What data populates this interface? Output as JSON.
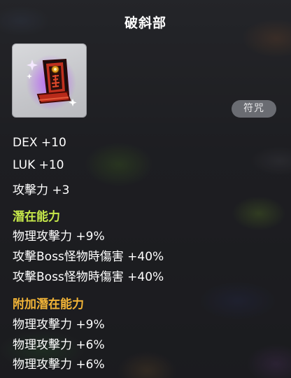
{
  "item": {
    "name": "破斜部",
    "category": "符咒",
    "icon": "talisman-icon"
  },
  "base_stats": [
    "DEX +10",
    "LUK +10",
    "攻擊力 +3"
  ],
  "potential": {
    "title": "潛在能力",
    "lines": [
      "物理攻擊力 +9%",
      "攻擊Boss怪物時傷害 +40%",
      "攻擊Boss怪物時傷害 +40%"
    ]
  },
  "bonus_potential": {
    "title": "附加潛在能力",
    "lines": [
      "物理攻擊力 +9%",
      "物理攻擊力 +6%",
      "物理攻擊力 +6%"
    ]
  },
  "colors": {
    "potential_title": "#c6e84a",
    "bonus_title": "#f2b437"
  }
}
